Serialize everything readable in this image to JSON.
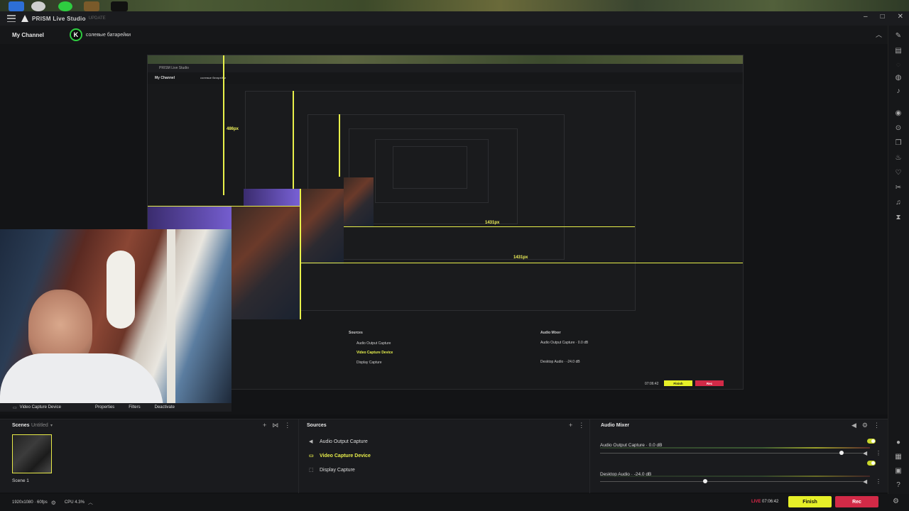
{
  "app": {
    "title": "PRISM Live Studio",
    "tag": "UPDATE",
    "window_controls": [
      "–",
      "□",
      "✕"
    ]
  },
  "channel": {
    "label": "My Channel",
    "avatar_letter": "K",
    "name": "солевые батарейки",
    "collapse_icon": "chevron-up-icon"
  },
  "preview": {
    "dimension_labels": [
      "486px",
      "1431px",
      "1431px"
    ]
  },
  "nested": {
    "sources": [
      "Audio Output Capture",
      "Video Capture Device",
      "Display Capture"
    ],
    "mixer_title": "Audio Mixer",
    "mixer_rows": [
      "Audio Output Capture · 0.0 dB",
      "Desktop Audio · -24.0 dB"
    ],
    "sources_title": "Sources",
    "finish": "Finish",
    "rec": "Rec",
    "time": "07:06:42"
  },
  "source_toolbar": {
    "name": "Video Capture Device",
    "properties": "Properties",
    "filters": "Filters",
    "deactivate": "Deactivate"
  },
  "scenes": {
    "title": "Scenes",
    "collection": "Untitled",
    "items": [
      {
        "label": "Scene 1"
      }
    ]
  },
  "sources": {
    "title": "Sources",
    "items": [
      {
        "label": "Audio Output Capture",
        "icon": "speaker-icon"
      },
      {
        "label": "Video Capture Device",
        "icon": "camera-icon"
      },
      {
        "label": "Display Capture",
        "icon": "display-icon"
      }
    ]
  },
  "mixer": {
    "title": "Audio Mixer",
    "rows": [
      {
        "name": "Audio Output Capture · 0.0 dB",
        "volume": 0.92
      },
      {
        "name": "Desktop Audio · -24.0 dB",
        "volume": 0.4
      }
    ]
  },
  "status": {
    "resolution": "1920x1080 · 60fps",
    "cpu": "CPU 4.3%",
    "live": "LIVE",
    "time": "07:06:42",
    "finish": "Finish",
    "rec": "Rec"
  },
  "colors": {
    "accent": "#e7f028",
    "rec": "#d22a47",
    "live": "#e0284a",
    "channel_ring": "#2ecc40"
  }
}
